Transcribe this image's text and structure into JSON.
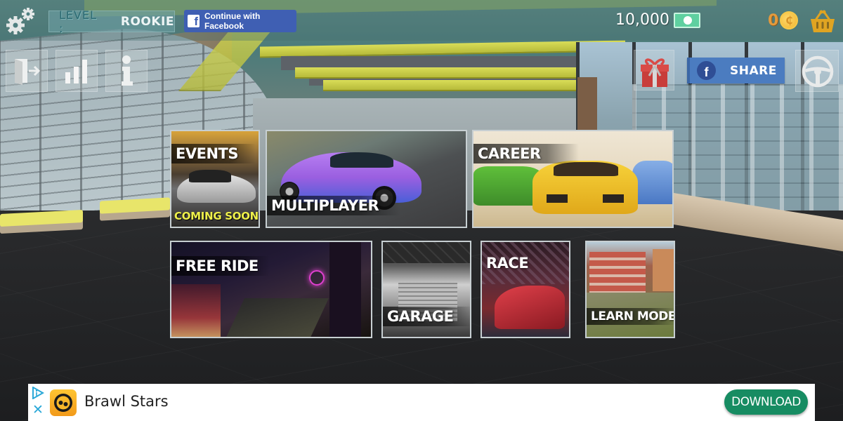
{
  "hud": {
    "level_label": "LEVEL :",
    "level_value": "ROOKIE",
    "facebook_login_label": "Continue with Facebook",
    "cash_value": "10,000",
    "coins_value": "0",
    "coin_symbol": "₵",
    "share_label": "SHARE",
    "facebook_glyph": "f"
  },
  "icons": {
    "settings": "gears-icon",
    "exit": "exit-door-icon",
    "leaderboard": "bar-chart-icon",
    "info": "info-icon",
    "gift": "gift-icon",
    "steering": "steering-wheel-icon",
    "shop": "basket-icon",
    "cash": "banknote-icon",
    "coin": "coin-icon"
  },
  "modes": [
    {
      "id": "events",
      "label": "EVENTS",
      "badge": "COMING SOON"
    },
    {
      "id": "multiplayer",
      "label": "MULTIPLAYER"
    },
    {
      "id": "career",
      "label": "CAREER"
    },
    {
      "id": "free-ride",
      "label": "FREE RIDE"
    },
    {
      "id": "garage",
      "label": "GARAGE"
    },
    {
      "id": "race",
      "label": "RACE"
    },
    {
      "id": "learn-mode",
      "label": "LEARN MODE"
    }
  ],
  "ad": {
    "app_name": "Brawl Stars",
    "cta_label": "DOWNLOAD",
    "close_glyph": "✕"
  },
  "colors": {
    "facebook_blue": "#3f5fb3",
    "share_blue": "#4b7cc0",
    "coin_orange": "#e49a3c",
    "coming_soon_yellow": "#eef04a",
    "download_green": "#178c62"
  }
}
